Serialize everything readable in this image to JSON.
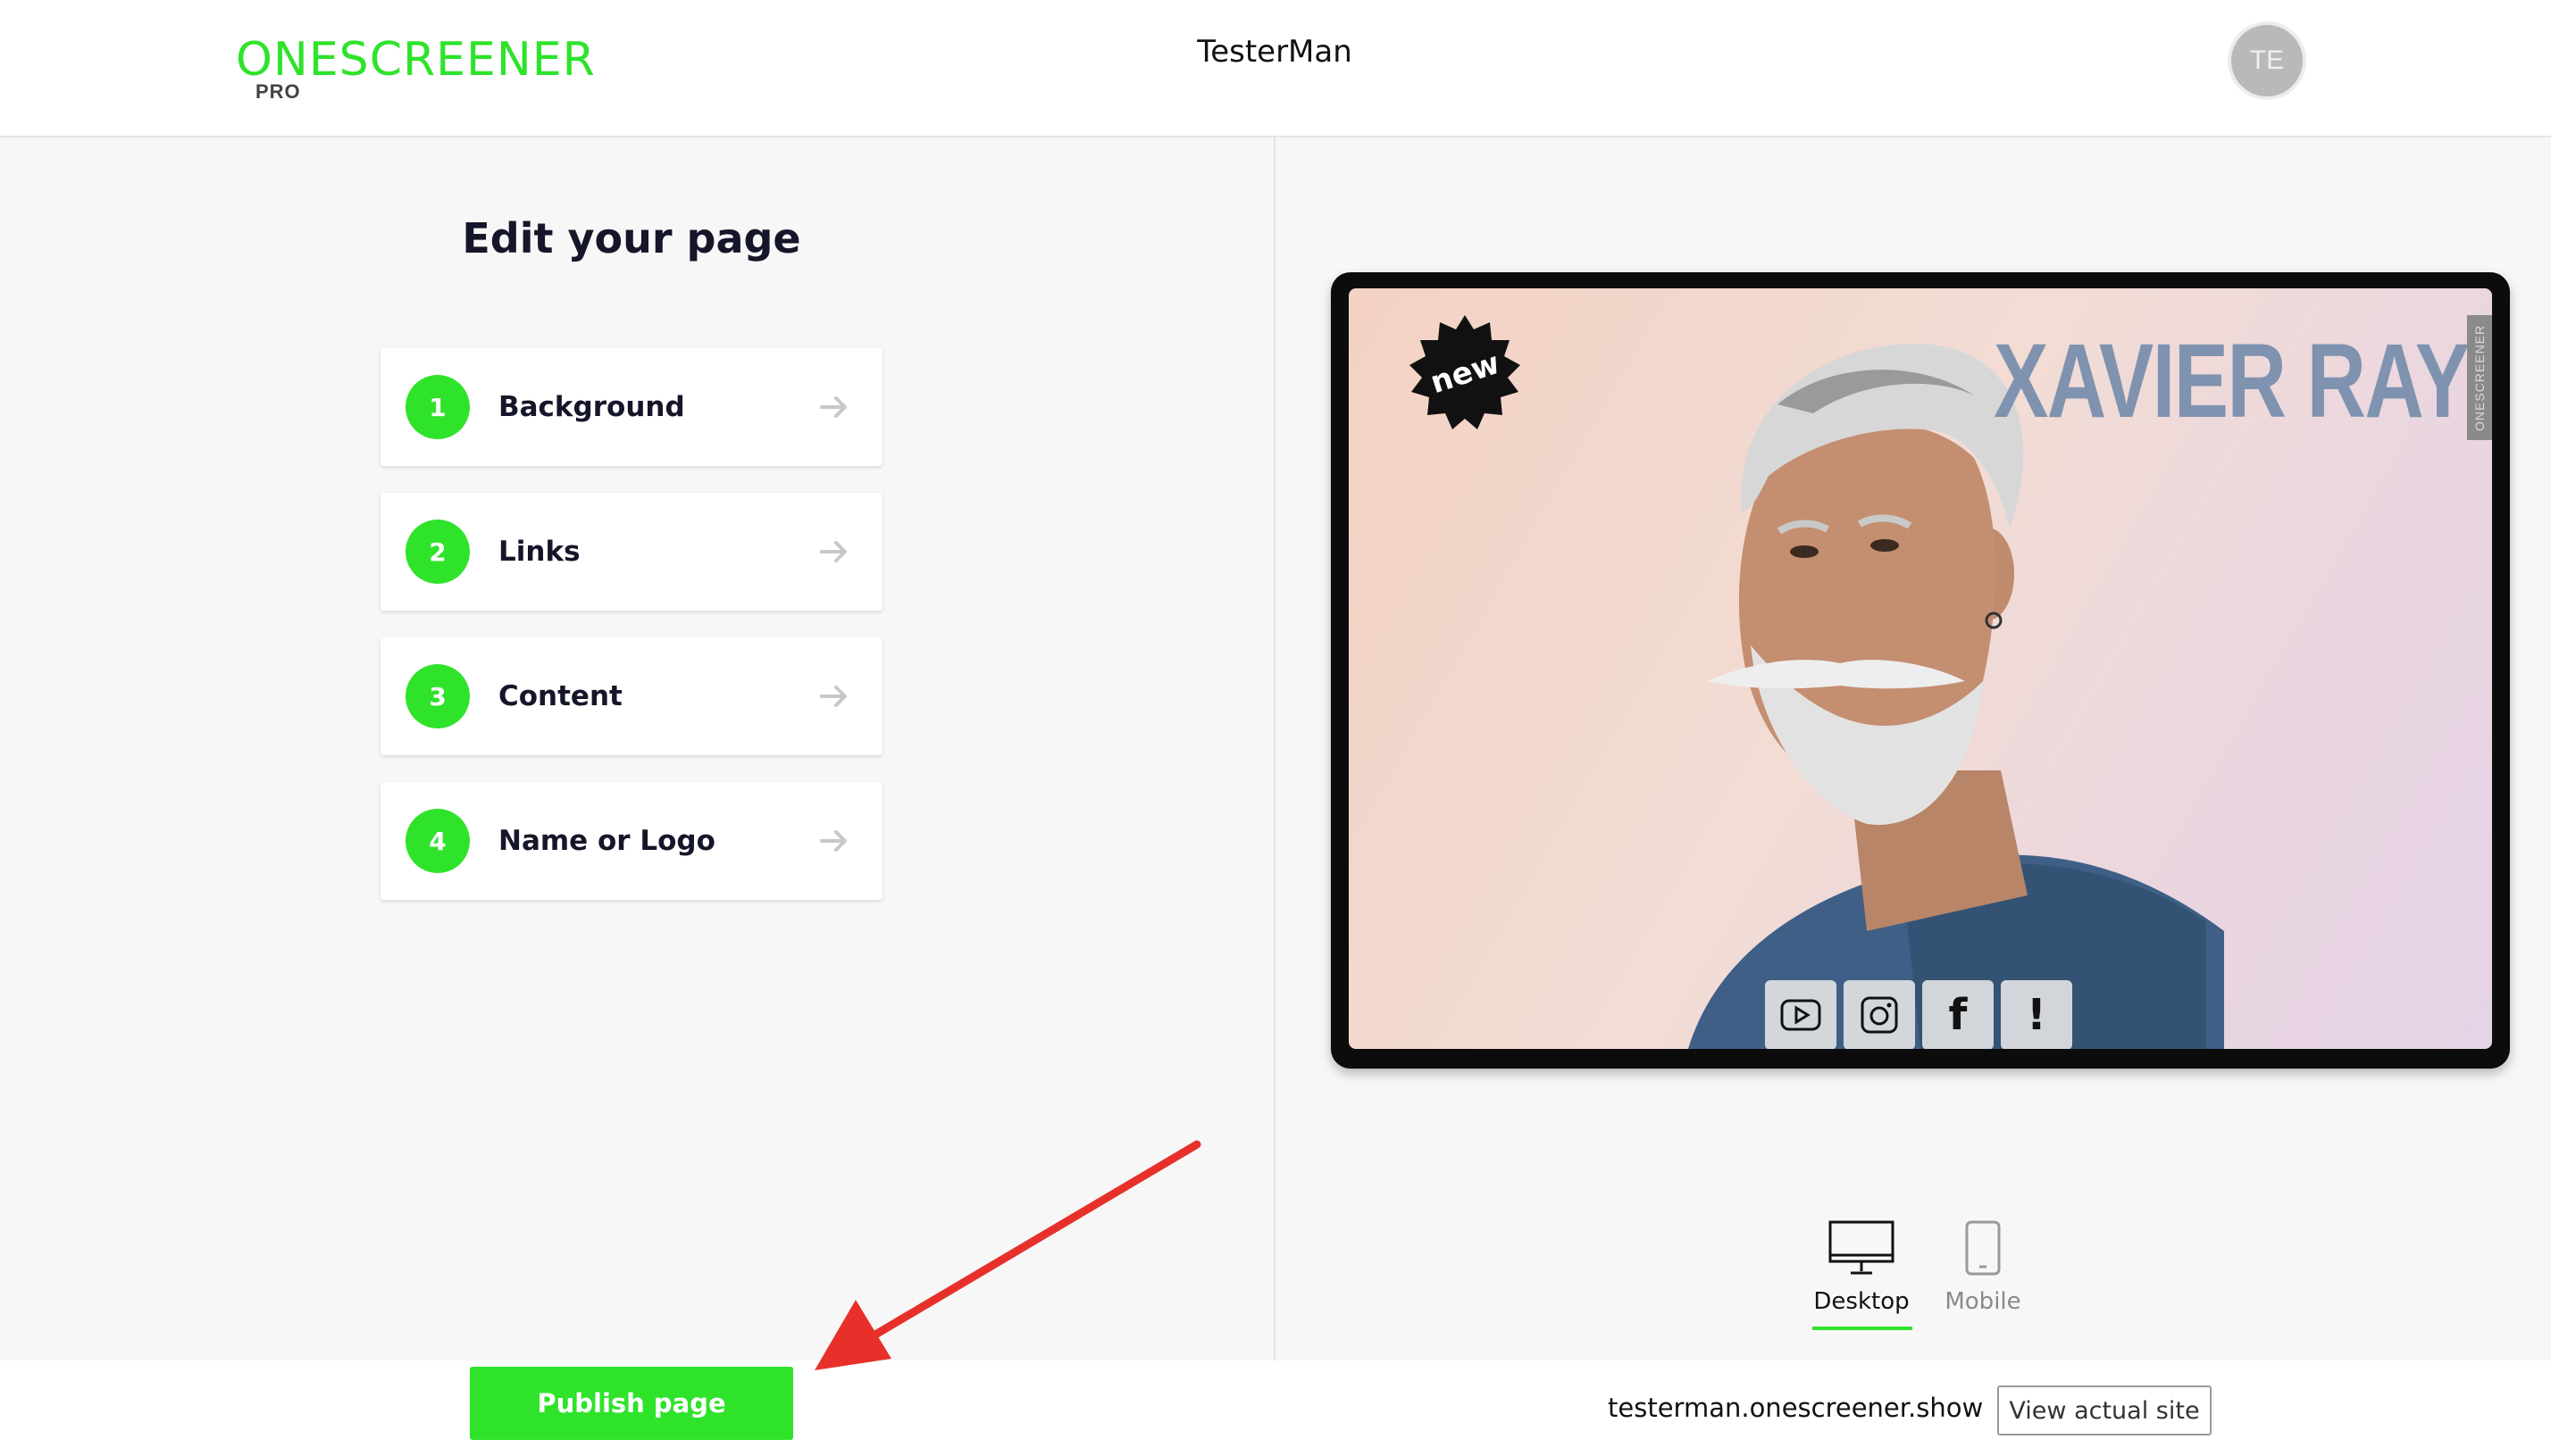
{
  "header": {
    "logo_text": "ONESCREENER",
    "logo_badge": "PRO",
    "site_title": "TesterMan",
    "avatar_initials": "TE"
  },
  "editor": {
    "title": "Edit your page",
    "steps": [
      {
        "number": "1",
        "label": "Background"
      },
      {
        "number": "2",
        "label": "Links"
      },
      {
        "number": "3",
        "label": "Content"
      },
      {
        "number": "4",
        "label": "Name or Logo"
      }
    ]
  },
  "preview": {
    "badge_text": "new",
    "brand_name": "XAVIER RAY",
    "watermark": "ONESCREENER",
    "social_icons": [
      "youtube-icon",
      "instagram-icon",
      "facebook-icon",
      "info-icon"
    ],
    "info_glyph": "!",
    "facebook_glyph": "f"
  },
  "device_switch": {
    "desktop_label": "Desktop",
    "mobile_label": "Mobile",
    "active": "Desktop"
  },
  "footer": {
    "publish_label": "Publish page",
    "site_url": "testerman.onescreener.show",
    "view_site_label": "View actual site"
  },
  "colors": {
    "accent": "#2ee32a",
    "brand_text": "#7f93b0",
    "annotation_arrow": "#e8302a"
  }
}
